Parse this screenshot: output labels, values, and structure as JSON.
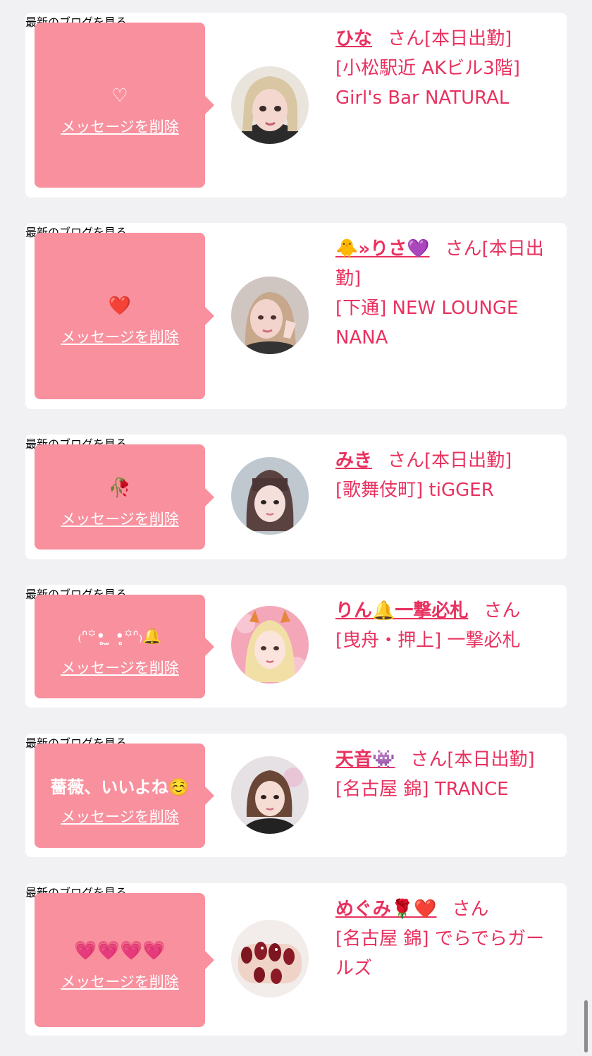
{
  "common": {
    "delete_label": "メッセージを削除",
    "blog_label": "最新のブログを見る",
    "san": "さん"
  },
  "cards": [
    {
      "message": "♡",
      "name": "ひな",
      "status": "[本日出勤]",
      "location": "[小松駅近 AKビル3階] Girl's Bar NATURAL"
    },
    {
      "message": "❤️",
      "name": "🐥»りさ💜",
      "status": "[本日出勤]",
      "location": "[下通] NEW LOUNGE NANA"
    },
    {
      "message": "🥀",
      "name": "みき",
      "status": "[本日出勤]",
      "location": "[歌舞伎町] tiGGER"
    },
    {
      "message": "₍ᐢ꙳•̥ ̫ •̥꙳ᐢ₎🔔",
      "name": "りん🔔一撃必札",
      "status": "",
      "location": "[曳舟・押上] 一撃必札"
    },
    {
      "message": "薔薇、いいよね☺️",
      "name": "天音👾",
      "status": "[本日出勤]",
      "location": "[名古屋 錦] TRANCE"
    },
    {
      "message": "💗💗💗💗",
      "name": "めぐみ🌹❤️",
      "status": "",
      "location": "[名古屋 錦] でらでらガールズ"
    }
  ],
  "colors": {
    "accent": "#e8315f",
    "bubble": "#f9909e",
    "background": "#f1f1f3",
    "link_gray": "#9a9a9a"
  }
}
